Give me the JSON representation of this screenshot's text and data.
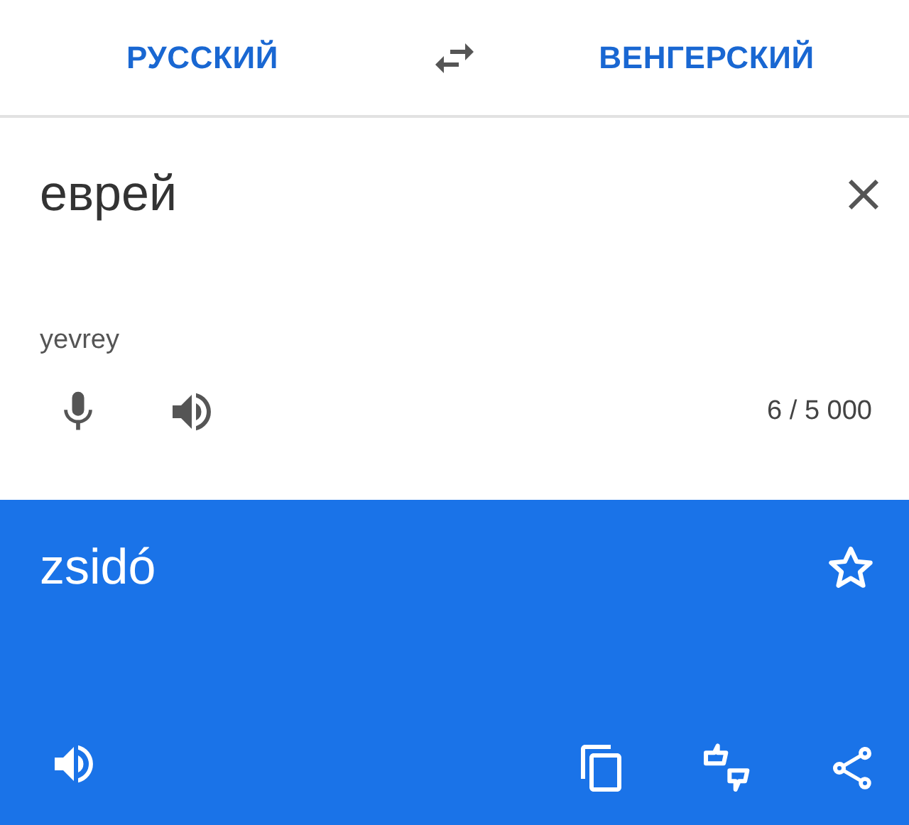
{
  "languages": {
    "source": "РУССКИЙ",
    "target": "ВЕНГЕРСКИЙ"
  },
  "input": {
    "text": "еврей",
    "transliteration": "yevrey",
    "counter": "6 / 5 000"
  },
  "output": {
    "text": "zsidó",
    "starred": false
  }
}
